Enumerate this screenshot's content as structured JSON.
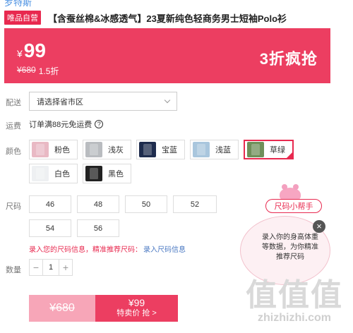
{
  "brand": {
    "link_label": "罗特斯"
  },
  "product": {
    "badge": "唯品自营",
    "title": "【含蚕丝棉&冰感透气】23夏新纯色轻商务男士短袖Polo衫"
  },
  "price": {
    "currency": "¥",
    "current": "99",
    "original": "¥680",
    "discount": "1.5折",
    "promo_tag": "3折疯抢"
  },
  "delivery": {
    "label": "配送",
    "select_value": "请选择省市区"
  },
  "shipping": {
    "label": "运费",
    "text": "订单满88元免运费",
    "help_symbol": "?"
  },
  "colors": {
    "label": "颜色",
    "options": [
      {
        "label": "粉色",
        "swatch": "#e9b9c4"
      },
      {
        "label": "浅灰",
        "swatch": "#b9bcc0"
      },
      {
        "label": "宝蓝",
        "swatch": "#1e2c4d"
      },
      {
        "label": "浅蓝",
        "swatch": "#a9c6dd"
      },
      {
        "label": "草绿",
        "swatch": "#6f8f5a",
        "selected": true
      },
      {
        "label": "白色",
        "swatch": "#eef0f2"
      },
      {
        "label": "黑色",
        "swatch": "#222222"
      }
    ]
  },
  "sizes": {
    "label": "尺码",
    "options": [
      "46",
      "48",
      "50",
      "52",
      "54",
      "56"
    ],
    "hint": "录入您的尺码信息，精准推荐尺码：",
    "hint_link": "录入尺码信息"
  },
  "quantity": {
    "label": "数量",
    "value": "1",
    "minus": "−",
    "plus": "+"
  },
  "buy": {
    "original": "¥680",
    "price": "¥99",
    "action": "特卖价 抢 >"
  },
  "size_helper": {
    "button": "尺码小帮手",
    "text": "录入你的身高体重等数据，为你精准推荐尺码",
    "close": "×"
  },
  "watermark": {
    "big": "值值值",
    "small": "zhizhizhi.com"
  },
  "colors_theme": {
    "accent": "#ec3e61",
    "link": "#4a78c2"
  }
}
